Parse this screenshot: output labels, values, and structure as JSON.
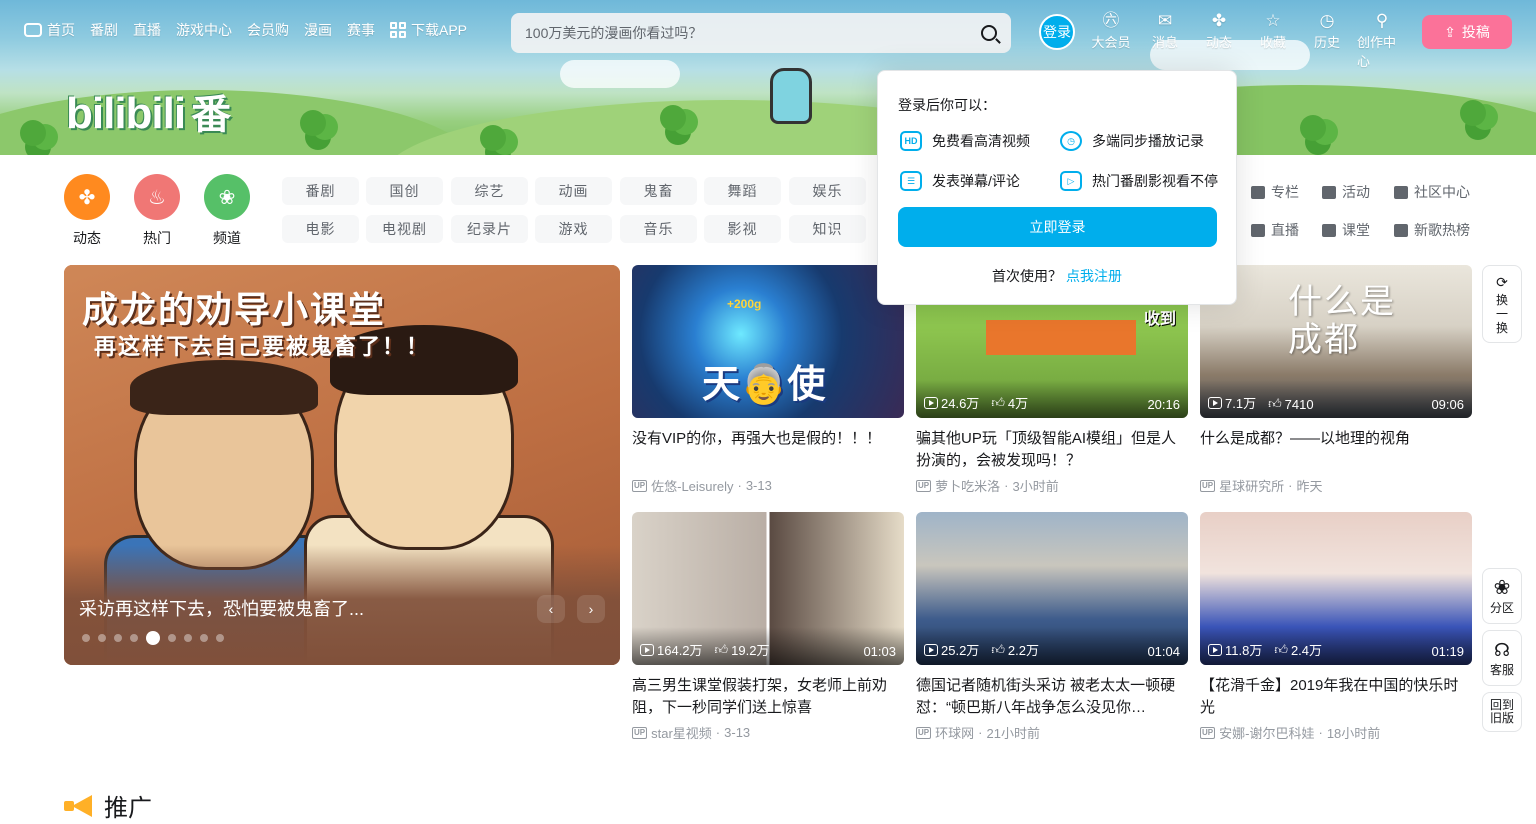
{
  "nav": {
    "home": "首页",
    "anime": "番剧",
    "live": "直播",
    "game_center": "游戏中心",
    "vip_shop": "会员购",
    "manga": "漫画",
    "esports": "赛事",
    "download_app": "下载APP"
  },
  "search": {
    "placeholder": "100万美元的漫画你看过吗？"
  },
  "header_right": {
    "login": "登录",
    "items": [
      {
        "label": "大会员",
        "icon": "big-vip-icon"
      },
      {
        "label": "消息",
        "icon": "message-icon"
      },
      {
        "label": "动态",
        "icon": "dynamic-icon"
      },
      {
        "label": "收藏",
        "icon": "favorite-icon"
      },
      {
        "label": "历史",
        "icon": "history-icon"
      },
      {
        "label": "创作中心",
        "icon": "creator-center-icon"
      }
    ],
    "upload": "投稿"
  },
  "banner": {
    "logo_text": "bilibili",
    "logo_badge": "番"
  },
  "channels": {
    "circles": [
      {
        "label": "动态",
        "color": "#ff6699"
      },
      {
        "label": "热门",
        "color": "#f07775"
      },
      {
        "label": "频道",
        "color": "#56c068"
      }
    ],
    "row1": [
      "番剧",
      "国创",
      "综艺",
      "动画",
      "鬼畜",
      "舞蹈",
      "娱乐"
    ],
    "row2": [
      "电影",
      "电视剧",
      "纪录片",
      "游戏",
      "音乐",
      "影视",
      "知识"
    ],
    "side": [
      "专栏",
      "活动",
      "社区中心",
      "直播",
      "课堂",
      "新歌热榜"
    ]
  },
  "carousel": {
    "art_title": "成龙的劝导小课堂",
    "art_subtitle": "再这样下去自己要被鬼畜了！！",
    "caption": "采访再这样下去，恐怕要被鬼畜了...",
    "active_dot": 5,
    "dot_count": 9
  },
  "videos": [
    {
      "title": "没有VIP的你，再强大也是假的！！！",
      "author": "佐悠-Leisurely",
      "date": "3-13",
      "views": "",
      "likes": "",
      "duration": ""
    },
    {
      "title": "骗其他UP玩「顶级智能AI模组」但是人扮演的，会被发现吗！？",
      "author": "萝卜吃米洛",
      "date": "3小时前",
      "views": "24.6万",
      "likes": "4万",
      "duration": "20:16"
    },
    {
      "title": "什么是成都？——以地理的视角",
      "author": "星球研究所",
      "date": "昨天",
      "views": "7.1万",
      "likes": "7410",
      "duration": "09:06"
    },
    {
      "title": "高三男生课堂假装打架，女老师上前劝阻，下一秒同学们送上惊喜",
      "author": "star星视频",
      "date": "3-13",
      "views": "164.2万",
      "likes": "19.2万",
      "duration": "01:03"
    },
    {
      "title": "德国记者随机街头采访 被老太太一顿硬怼：“顿巴斯八年战争怎么没见你…",
      "author": "环球网",
      "date": "21小时前",
      "views": "25.2万",
      "likes": "2.2万",
      "duration": "01:04"
    },
    {
      "title": "【花滑千金】2019年我在中国的快乐时光",
      "author": "安娜-谢尔巴科娃",
      "date": "18小时前",
      "views": "11.8万",
      "likes": "2.4万",
      "duration": "01:19"
    }
  ],
  "thumb_overlays": {
    "t1_text": "天👵使",
    "t1_badge": "+200g",
    "t2_text": "收到",
    "t3_text": "什么是成都"
  },
  "up_badge": "UP",
  "popover": {
    "title": "登录后你可以：",
    "features": [
      "免费看高清视频",
      "多端同步播放记录",
      "发表弹幕/评论",
      "热门番剧影视看不停"
    ],
    "feature_badge": "HD",
    "login_button": "立即登录",
    "first_use": "首次使用？",
    "register": "点我注册"
  },
  "float": {
    "refresh": "换一换",
    "partition": "分区",
    "service": "客服",
    "old_version": "回到旧版"
  },
  "promo": {
    "title": "推广"
  },
  "colors": {
    "brand_blue": "#00aeec",
    "brand_pink": "#fb7299",
    "text_main": "#18191c",
    "text_muted": "#9499a0"
  }
}
